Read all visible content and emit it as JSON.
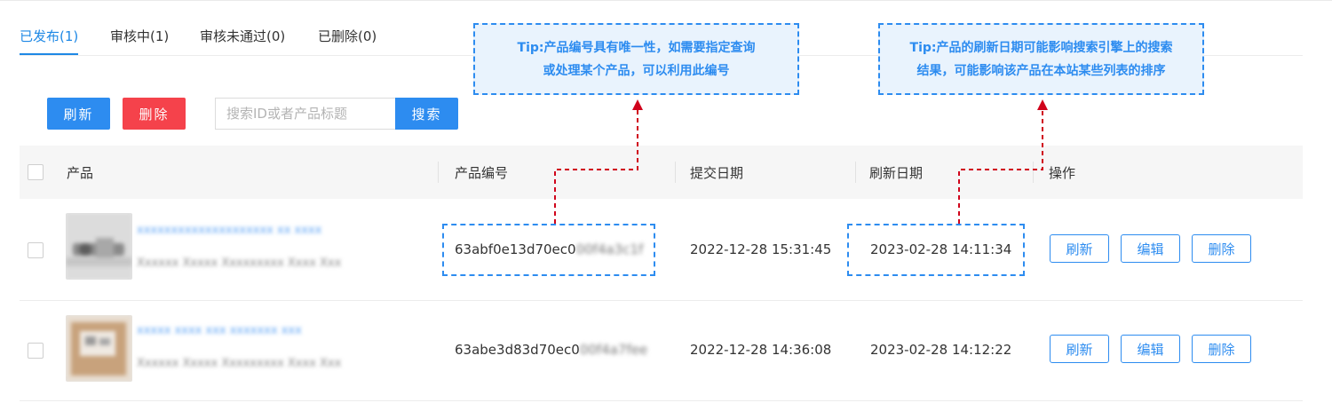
{
  "tabs": [
    {
      "label": "已发布(1)",
      "active": true
    },
    {
      "label": "审核中(1)",
      "active": false
    },
    {
      "label": "审核未通过(0)",
      "active": false
    },
    {
      "label": "已删除(0)",
      "active": false
    }
  ],
  "toolbar": {
    "refresh_label": "刷新",
    "delete_label": "删除",
    "search_placeholder": "搜索ID或者产品标题",
    "search_label": "搜索"
  },
  "table": {
    "headers": {
      "product": "产品",
      "product_id": "产品编号",
      "submit_date": "提交日期",
      "refresh_date": "刷新日期",
      "actions": "操作"
    },
    "rows": [
      {
        "title": "xxxxxxxxxxxxxxxxxxxx xx xxxx",
        "subtitle": "Xxxxxx Xxxxx Xxxxxxxxx Xxxx Xxx",
        "id_visible": "63abf0e13d70ec0",
        "id_hidden": "00f4a3c1f",
        "submit_date": "2022-12-28 15:31:45",
        "refresh_date": "2023-02-28 14:11:34",
        "actions": {
          "refresh": "刷新",
          "edit": "编辑",
          "delete": "删除"
        }
      },
      {
        "title": "xxxxx xxxx xxx xxxxxxx xxx",
        "subtitle": "Xxxxxx Xxxxx Xxxxxxxxx Xxxx Xxx",
        "id_visible": "63abe3d83d70ec0",
        "id_hidden": "00f4a7fee",
        "submit_date": "2022-12-28 14:36:08",
        "refresh_date": "2023-02-28 14:12:22",
        "actions": {
          "refresh": "刷新",
          "edit": "编辑",
          "delete": "删除"
        }
      }
    ]
  },
  "annotations": {
    "tip_id_line1": "Tip:产品编号具有唯一性，如需要指定查询",
    "tip_id_line2": "或处理某个产品，可以利用此编号",
    "tip_date_line1": "Tip:产品的刷新日期可能影响搜索引擎上的搜索",
    "tip_date_line2": "结果，可能影响该产品在本站某些列表的排序"
  },
  "colors": {
    "accent": "#2d8cf0",
    "danger": "#f5424b",
    "arrow": "#d0021b"
  }
}
